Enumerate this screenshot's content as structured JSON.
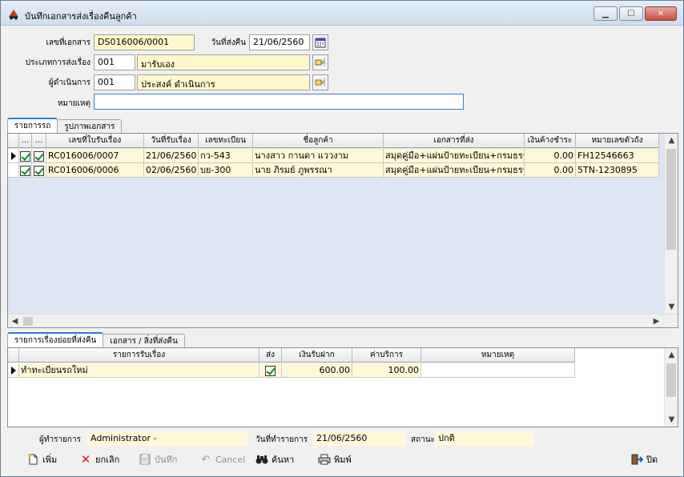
{
  "window": {
    "title": "บันทึกเอกสารส่งเรื่องคืนลูกค้า",
    "controls": {
      "minimize": "▁",
      "maximize": "☐",
      "close": "✕"
    }
  },
  "header": {
    "doc_no_label": "เลขที่เอกสาร",
    "doc_no": "DS016006/0001",
    "send_date_label": "วันที่ส่งคืน",
    "send_date": "21/06/2560",
    "send_type_label": "ประเภทการส่งเรื่อง",
    "send_type_code": "001",
    "send_type_name": "มารับเอง",
    "operator_label": "ผู้ดำเนินการ",
    "operator_code": "001",
    "operator_name": "ประสงค์ ดำเนินการ",
    "remark_label": "หมายเหตุ",
    "remark": ""
  },
  "top_tabs": [
    {
      "label": "รายการรถ",
      "active": true
    },
    {
      "label": "รูปภาพเอกสาร",
      "active": false
    }
  ],
  "car_grid": {
    "columns": [
      "...",
      "...",
      "เลขที่ใบรับเรื่อง",
      "วันที่รับเรื่อง",
      "เลขทะเบียน",
      "ชื่อลูกค้า",
      "เอกสารที่ส่ง",
      "เงินค้างชำระ",
      "หมายเลขตัวถัง"
    ],
    "rows": [
      {
        "receipt_no": "RC016006/0007",
        "receipt_date": "21/06/2560",
        "plate": "กว-543",
        "customer": "นางสาว กานดา แววงาม",
        "documents": "สมุดคู่มือ+แผ่นป้ายทะเบียน+กรมธรรม์",
        "outstanding": "0.00",
        "chassis": "FH12546663"
      },
      {
        "receipt_no": "RC016006/0006",
        "receipt_date": "02/06/2560",
        "plate": "บย-300",
        "customer": "นาย ภิรมย์ ภูพรรณา",
        "documents": "สมุดคู่มือ+แผ่นป้ายทะเบียน+กรมธรรม์",
        "outstanding": "0.00",
        "chassis": "5TN-1230895"
      }
    ]
  },
  "bottom_tabs": [
    {
      "label": "รายการเรื่องย่อยที่ส่งคืน",
      "active": true
    },
    {
      "label": "เอกสาร / สิ่งที่ส่งคืน",
      "active": false
    }
  ],
  "sub_grid": {
    "columns": [
      "รายการรับเรื่อง",
      "ส่ง",
      "เงินรับฝาก",
      "ค่าบริการ",
      "หมายเหตุ"
    ],
    "rows": [
      {
        "item": "ทำทะเบียนรถใหม่",
        "sent": true,
        "deposit": "600.00",
        "service_fee": "100.00",
        "remark": ""
      }
    ]
  },
  "status": {
    "creator_label": "ผู้ทำรายการ",
    "creator": "Administrator -",
    "trans_date_label": "วันที่ทำรายการ",
    "trans_date": "21/06/2560",
    "state_label": "สถานะ",
    "state": "ปกติ"
  },
  "toolbar": {
    "add": "เพิ่ม",
    "cancel_doc": "ยกเลิก",
    "save": "บันทึก",
    "cancel": "Cancel",
    "search": "ค้นหา",
    "print": "พิมพ์",
    "close": "ปิด"
  },
  "colors": {
    "field_yellow": "#fff8cc",
    "grid_row": "#fff8d8",
    "grid_empty": "#dde6f5",
    "accent_blue": "#2c7ad6",
    "check_green": "#0b8a1c",
    "delete_red": "#d21c1c"
  }
}
